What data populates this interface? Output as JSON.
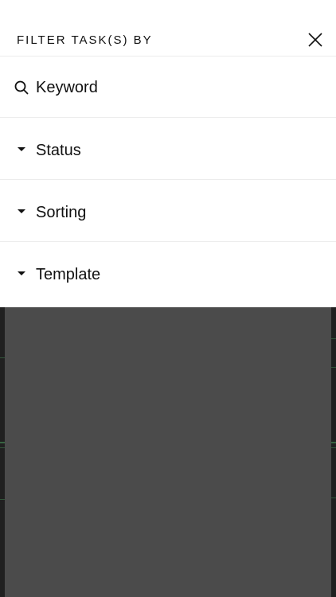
{
  "panel": {
    "title": "FILTER TASK(S) BY"
  },
  "search": {
    "placeholder": "Keyword",
    "value": ""
  },
  "sections": [
    {
      "label": "Status"
    },
    {
      "label": "Sorting"
    },
    {
      "label": "Template"
    }
  ],
  "colors": {
    "panel_bg": "#ffffff",
    "overlay": "#4b4b4b",
    "divider": "#ececec",
    "text": "#111111",
    "background_accent": "#3f7a4c"
  },
  "icons": {
    "close": "close-icon",
    "search": "search-icon",
    "caret": "caret-down-icon"
  }
}
